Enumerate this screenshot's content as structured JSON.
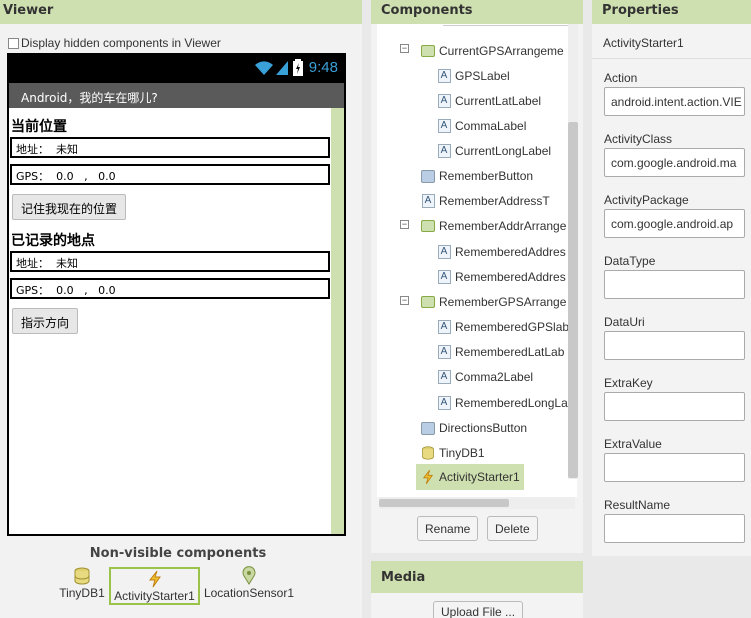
{
  "viewer": {
    "title": "Viewer",
    "hidden_checkbox_label": "Display hidden components in Viewer",
    "status_time": "9:48",
    "app_title": "Android，我的车在哪儿?",
    "current_location_label": "当前位置",
    "current_address": "地址：  未知",
    "current_gps": "GPS：  0.0   ,   0.0",
    "remember_button": "记住我现在的位置",
    "saved_location_label": "已记录的地点",
    "saved_address": "地址：  未知",
    "saved_gps": "GPS：  0.0   ,   0.0",
    "directions_button": "指示方向",
    "nonvisible_title": "Non-visible components",
    "nonvisible": [
      {
        "label": "TinyDB1",
        "icon": "database-icon"
      },
      {
        "label": "ActivityStarter1",
        "icon": "lightning-icon"
      },
      {
        "label": "LocationSensor1",
        "icon": "location-pin-icon"
      }
    ]
  },
  "components": {
    "title": "Components",
    "tree": [
      {
        "label": "CurrentGPSArrangeme",
        "icon": "arrangement-icon",
        "toggle": "−"
      },
      {
        "label": "GPSLabel",
        "icon": "label-icon"
      },
      {
        "label": "CurrentLatLabel",
        "icon": "label-icon"
      },
      {
        "label": "CommaLabel",
        "icon": "label-icon"
      },
      {
        "label": "CurrentLongLabel",
        "icon": "label-icon"
      },
      {
        "label": "RememberButton",
        "icon": "button-icon"
      },
      {
        "label": "RememberAddressT",
        "icon": "label-icon"
      },
      {
        "label": "RememberAddrArrange",
        "icon": "arrangement-icon",
        "toggle": "−"
      },
      {
        "label": "RememberedAddres",
        "icon": "label-icon"
      },
      {
        "label": "RememberedAddres",
        "icon": "label-icon"
      },
      {
        "label": "RememberGPSArrange",
        "icon": "arrangement-icon",
        "toggle": "−"
      },
      {
        "label": "RememberedGPSlab",
        "icon": "label-icon"
      },
      {
        "label": "RememberedLatLab",
        "icon": "label-icon"
      },
      {
        "label": "Comma2Label",
        "icon": "label-icon"
      },
      {
        "label": "RememberedLongLa",
        "icon": "label-icon"
      },
      {
        "label": "DirectionsButton",
        "icon": "button-icon"
      },
      {
        "label": "TinyDB1",
        "icon": "database-icon"
      },
      {
        "label": "ActivityStarter1",
        "icon": "lightning-icon"
      }
    ],
    "rename": "Rename",
    "delete": "Delete"
  },
  "media": {
    "title": "Media",
    "upload": "Upload File ..."
  },
  "properties": {
    "title": "Properties",
    "component": "ActivityStarter1",
    "items": [
      {
        "name": "Action",
        "value": "android.intent.action.VIE"
      },
      {
        "name": "ActivityClass",
        "value": "com.google.android.ma"
      },
      {
        "name": "ActivityPackage",
        "value": "com.google.android.ap"
      },
      {
        "name": "DataType",
        "value": ""
      },
      {
        "name": "DataUri",
        "value": ""
      },
      {
        "name": "ExtraKey",
        "value": ""
      },
      {
        "name": "ExtraValue",
        "value": ""
      },
      {
        "name": "ResultName",
        "value": ""
      }
    ]
  }
}
